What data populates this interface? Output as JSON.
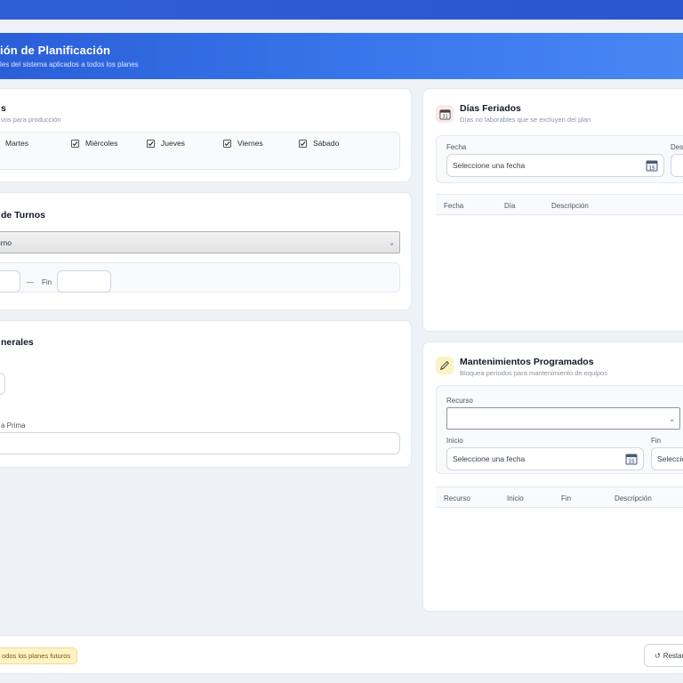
{
  "header": {
    "title": "ión de Planificación",
    "subtitle": "les del sistema aplicados a todos los planes"
  },
  "working_days": {
    "title": "s",
    "subtitle": "vos para producción",
    "days": [
      "Martes",
      "Miércoles",
      "Jueves",
      "Viernes",
      "Sábado"
    ]
  },
  "shifts": {
    "title": "de Turnos",
    "select_value": "urno",
    "separator": "—",
    "end_label": "Fin"
  },
  "general": {
    "title": "nerales",
    "field_label": "a Prima"
  },
  "holidays": {
    "title": "Días Feriados",
    "subtitle": "Días no laborables que se excluyen del plan",
    "date_label": "Fecha",
    "description_label": "Desc",
    "date_placeholder": "Seleccione una fecha",
    "calendar_icon_day": "31",
    "calendar_icon_small": "15",
    "columns": [
      "Fecha",
      "Día",
      "Descripción"
    ],
    "icon": "calendar-icon"
  },
  "maintenance": {
    "title": "Mantenimientos Programados",
    "subtitle": "Bloquea períodos para mantenimiento de equipos",
    "resource_label": "Recurso",
    "start_label": "Inicio",
    "end_label": "Fin",
    "start_placeholder": "Seleccione una fecha",
    "end_placeholder": "Seleccio",
    "calendar_icon_small": "15",
    "columns": [
      "Recurso",
      "Inicio",
      "Fin",
      "Descripción"
    ],
    "icon": "pencil-icon"
  },
  "footer": {
    "warning": "odos los planes futuros",
    "restore_button": "Restaur",
    "restore_icon": "↺"
  },
  "colors": {
    "brand": "#2f5fd8",
    "warning_bg": "#fdf3c7"
  }
}
